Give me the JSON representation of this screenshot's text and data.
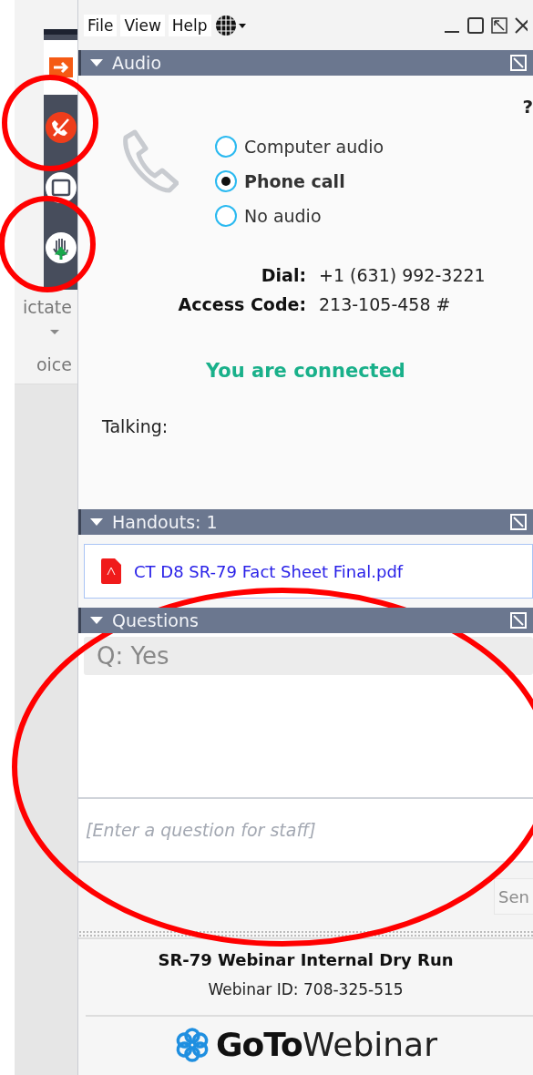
{
  "left_toolbar": {
    "labels": [
      "ictate",
      "oice"
    ]
  },
  "menu": [
    "File",
    "View",
    "Help"
  ],
  "audio": {
    "title": "Audio",
    "expanded": true,
    "help": "?",
    "options": [
      {
        "label": "Computer audio",
        "selected": false
      },
      {
        "label": "Phone call",
        "selected": true
      },
      {
        "label": "No audio",
        "selected": false
      }
    ],
    "dial_label": "Dial:",
    "dial": "+1 (631) 992-3221",
    "access_label": "Access Code:",
    "access": "213-105-458 #",
    "status": "You are connected",
    "talking_label": "Talking:"
  },
  "handouts": {
    "title": "Handouts: 1",
    "expanded": true,
    "files": [
      "CT D8 SR-79 Fact Sheet Final.pdf"
    ]
  },
  "questions": {
    "title": "Questions",
    "expanded": true,
    "items": [
      "Q: Yes"
    ],
    "placeholder": "[Enter a question for staff]",
    "send": "Sen"
  },
  "footer": {
    "title": "SR-79 Webinar Internal Dry Run",
    "webinar_id": "Webinar ID: 708-325-515",
    "logo_bold": "GoTo",
    "logo_light": "Webinar"
  }
}
